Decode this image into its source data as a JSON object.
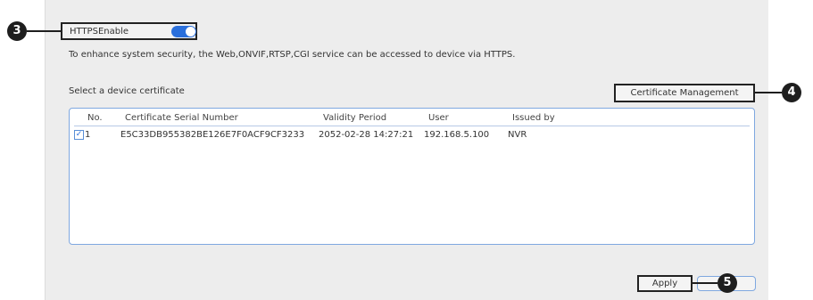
{
  "https": {
    "label": "HTTPSEnable",
    "enabled": true
  },
  "description": "To enhance system security, the Web,ONVIF,RTSP,CGI service can be accessed to device via HTTPS.",
  "certificate": {
    "select_label": "Select a device certificate",
    "management_button": "Certificate Management"
  },
  "table": {
    "headers": {
      "no": "No.",
      "serial": "Certificate Serial Number",
      "validity": "Validity Period",
      "user": "User",
      "issued": "Issued by"
    },
    "rows": [
      {
        "checked": true,
        "no": "1",
        "serial": "E5C33DB955382BE126E7F0ACF9CF3233",
        "validity": "2052-02-28 14:27:21",
        "user": "192.168.5.100",
        "issued": "NVR"
      }
    ]
  },
  "footer": {
    "apply_label": "Apply"
  },
  "callouts": {
    "c3": "3",
    "c4": "4",
    "c5": "5"
  },
  "colors": {
    "accent": "#2a6fdb",
    "callout": "#1e1e1e",
    "panel": "#ededed"
  }
}
